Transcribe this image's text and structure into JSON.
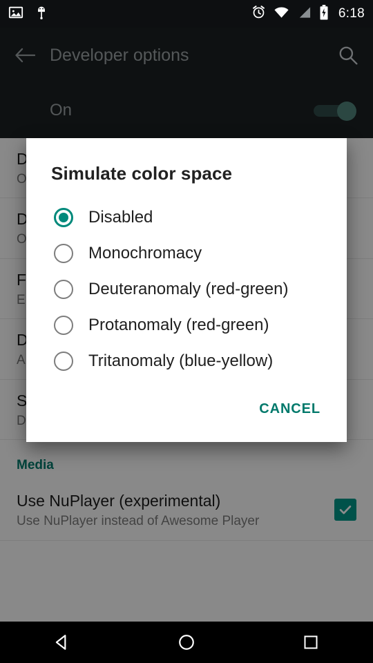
{
  "status_bar": {
    "left_icons": [
      "screenshot-icon",
      "android-debug-icon"
    ],
    "right_icons": [
      "alarm-icon",
      "wifi-icon",
      "signal-icon",
      "battery-charging-icon"
    ],
    "time": "6:18"
  },
  "toolbar": {
    "back_icon": "back-arrow-icon",
    "title": "Developer options",
    "search_icon": "search-icon"
  },
  "master_switch": {
    "label": "On",
    "state": "on"
  },
  "background_list": {
    "rows": [
      {
        "title": "D",
        "subtitle": "O"
      },
      {
        "title": "D",
        "subtitle": "O"
      },
      {
        "title": "F",
        "subtitle": "E"
      },
      {
        "title": "D",
        "subtitle": "A"
      },
      {
        "title": "S",
        "subtitle": "Disabled"
      }
    ],
    "category_header": "Media",
    "last_row": {
      "title": "Use NuPlayer (experimental)",
      "checked": true
    }
  },
  "dialog": {
    "title": "Simulate color space",
    "options": [
      {
        "label": "Disabled",
        "selected": true
      },
      {
        "label": "Monochromacy",
        "selected": false
      },
      {
        "label": "Deuteranomaly (red-green)",
        "selected": false
      },
      {
        "label": "Protanomaly (red-green)",
        "selected": false
      },
      {
        "label": "Tritanomaly (blue-yellow)",
        "selected": false
      }
    ],
    "cancel_label": "CANCEL"
  },
  "nav_bar": {
    "back": "nav-back-icon",
    "home": "nav-home-icon",
    "recents": "nav-recents-icon"
  },
  "colors": {
    "accent": "#009688",
    "accent_dark": "#00796b",
    "toolbar_bg": "#1b1f22",
    "status_bg": "#0d0f11"
  }
}
